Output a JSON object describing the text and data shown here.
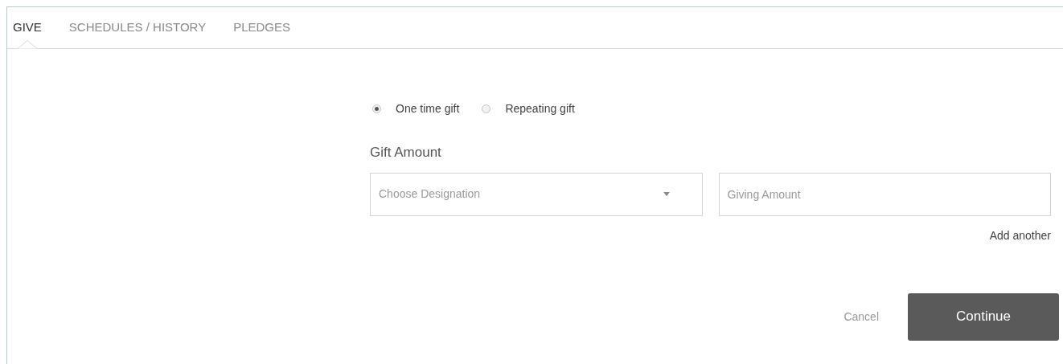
{
  "tabs": [
    {
      "label": "GIVE",
      "selected": true
    },
    {
      "label": "SCHEDULES / HISTORY",
      "selected": false
    },
    {
      "label": "PLEDGES",
      "selected": false
    }
  ],
  "gift_type": [
    {
      "label": "One time gift",
      "selected": true
    },
    {
      "label": "Repeating gift",
      "selected": false
    }
  ],
  "gift_amount": {
    "heading": "Gift Amount",
    "designation": {
      "placeholder": "Choose Designation"
    },
    "amount": {
      "placeholder": "Giving Amount"
    },
    "add_another": "Add another"
  },
  "actions": {
    "cancel": "Cancel",
    "continue": "Continue"
  }
}
